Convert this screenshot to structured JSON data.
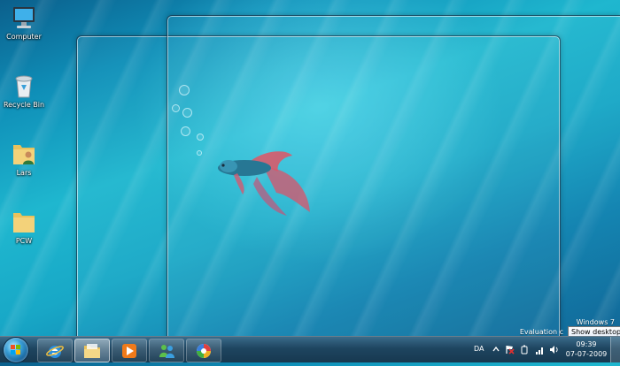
{
  "desktop": {
    "icons": [
      {
        "label": "Computer",
        "icon": "computer-icon"
      },
      {
        "label": "Recycle Bin",
        "icon": "recycle-bin-icon"
      },
      {
        "label": "Lars",
        "icon": "user-folder-icon"
      },
      {
        "label": "PCW",
        "icon": "folder-icon"
      }
    ],
    "watermark": {
      "line1": "Windows 7",
      "line2": "Evaluation c"
    }
  },
  "tooltip": "Show desktop",
  "taskbar": {
    "pinned": [
      {
        "name": "internet-explorer",
        "icon": "internet-explorer-icon"
      },
      {
        "name": "windows-explorer",
        "icon": "folder-icon",
        "active": true
      },
      {
        "name": "media-player",
        "icon": "media-player-icon"
      },
      {
        "name": "messenger",
        "icon": "messenger-icon"
      },
      {
        "name": "photo-gallery",
        "icon": "photo-gallery-icon"
      }
    ],
    "language": "DA",
    "tray_icons": [
      "chevron-up-icon",
      "action-center-flag-icon",
      "power-icon",
      "network-icon",
      "volume-icon"
    ],
    "clock": {
      "time": "09:39",
      "date": "07-07-2009"
    }
  },
  "colors": {
    "taskbar": "#1e4560",
    "desktop_accent": "#1fb7cf"
  }
}
